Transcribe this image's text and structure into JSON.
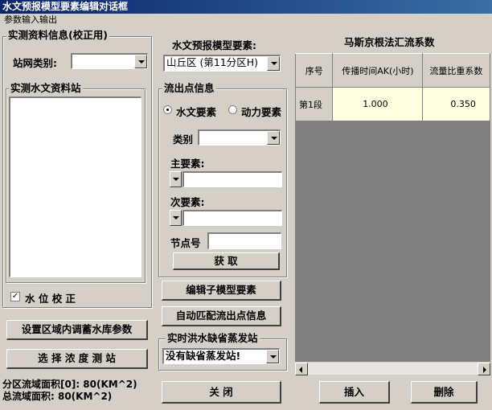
{
  "window": {
    "title": "水文预报模型要素编辑对话框"
  },
  "menu": {
    "tab": "参数输入输出"
  },
  "measured_info": {
    "group_label": "实测资料信息(校正用)",
    "station_type_label": "站网类别:",
    "station_type_value": "",
    "stations_group_label": "实测水文资料站",
    "water_level_check_label": "水 位 校 正",
    "water_level_checked": true
  },
  "model": {
    "element_label": "水文预报模型要素:",
    "element_value": "山丘区 (第11分区H)"
  },
  "outflow": {
    "group_label": "流出点信息",
    "radio_hydro": "水文要素",
    "radio_dynamic": "动力要素",
    "selected": "hydro",
    "category_label": "类别",
    "category_value": "",
    "main_element_label": "主要素:",
    "main_element_value": "",
    "secondary_element_label": "次要素:",
    "secondary_element_value": "",
    "node_label": "节点号",
    "node_value": "",
    "fetch_button": "获    取"
  },
  "buttons": {
    "edit_submodel": "编辑子模型要素",
    "auto_match": "自动匹配流出点信息",
    "set_reservoir": "设置区域内调蓄水库参数",
    "select_station": "选 择 浓 度 测 站",
    "close": "关    闭",
    "insert": "插入",
    "delete": "删除"
  },
  "evaporation": {
    "group_label": "实时洪水缺省蒸发站",
    "value": "没有缺省蒸发站!"
  },
  "areas": {
    "sub_area": "分区流域面积[0]: 80(KM^2)",
    "total_area": "总流域面积: 80(KM^2)"
  },
  "muskingum": {
    "title": "马斯京根法汇流系数",
    "columns": [
      "序号",
      "传播时间AK(小时)",
      "流量比重系数"
    ],
    "rows": [
      {
        "label": "第1段",
        "ak": "1.000",
        "ratio": "0.350"
      }
    ]
  }
}
